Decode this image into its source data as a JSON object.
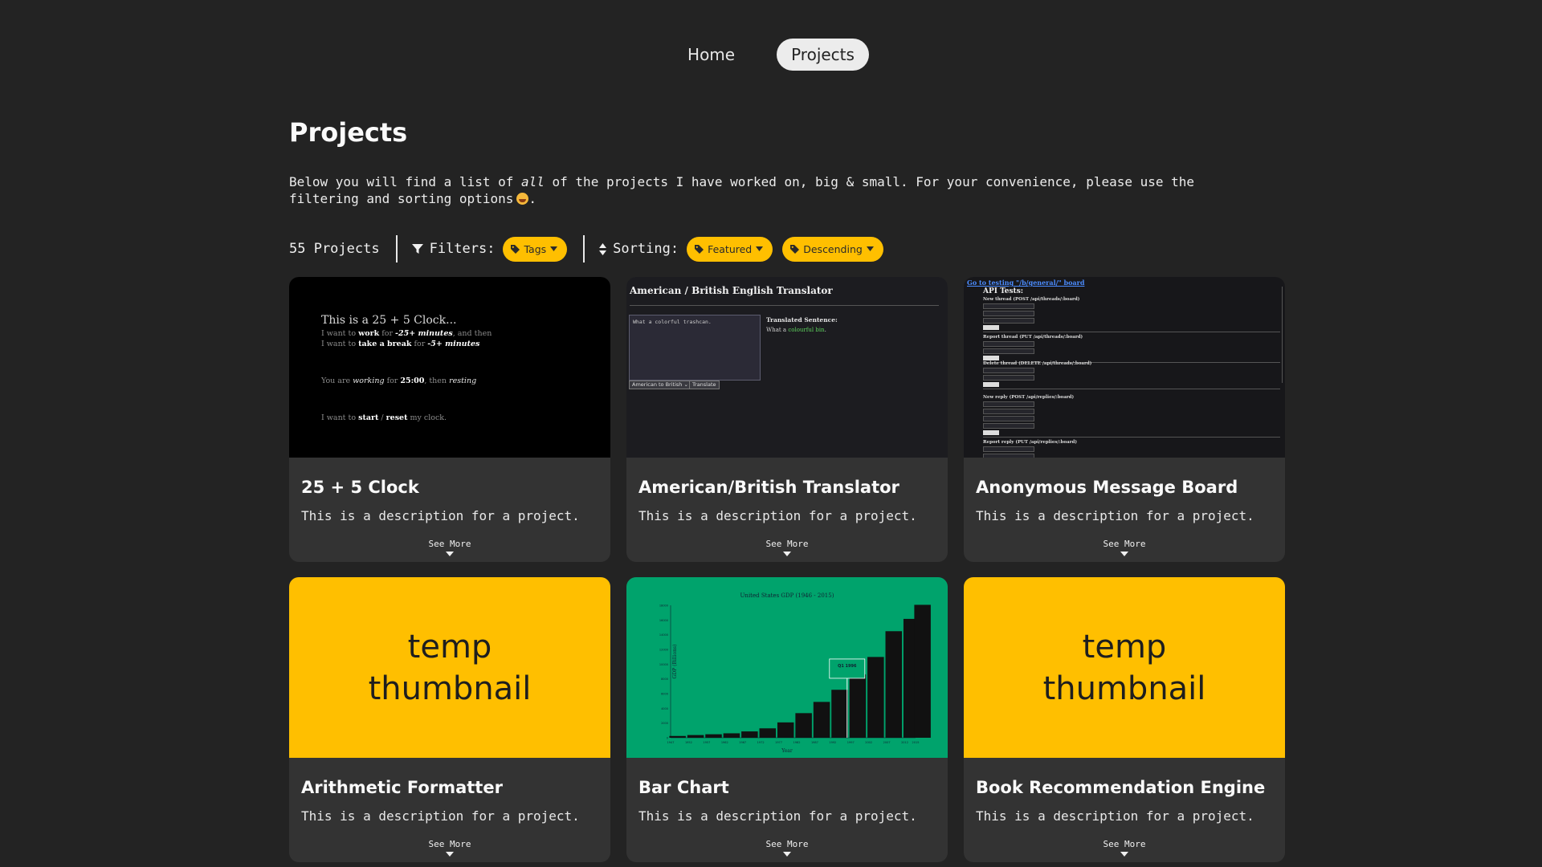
{
  "nav": {
    "home": "Home",
    "projects": "Projects"
  },
  "page": {
    "title": "Projects",
    "intro_before": "Below you will find a list of ",
    "intro_em": "all",
    "intro_after": " of the projects I have worked on, big & small. For your convenience, please use the filtering and sorting options",
    "intro_end": "."
  },
  "controls": {
    "count": "55 Projects",
    "filters_label": "Filters:",
    "tags_label": "Tags",
    "sorting_label": "Sorting:",
    "sort_field": "Featured",
    "sort_order": "Descending"
  },
  "colors": {
    "accent": "#ffbf00",
    "background": "#232323",
    "card": "#333333",
    "chart_green": "#00a36c"
  },
  "cards": [
    {
      "title": "25 + 5 Clock",
      "description": "This is a description for a project.",
      "see_more": "See More",
      "thumb": {
        "heading": "This is a 25 + 5 Clock...",
        "line1_a": "I want to ",
        "line1_b": "work",
        "line1_c": " for ",
        "line1_d": "-25+ minutes",
        "line1_e": ", and then",
        "line2_a": "I want to ",
        "line2_b": "take a break",
        "line2_c": " for ",
        "line2_d": "-5+ minutes",
        "status_a": "You are ",
        "status_b": "working",
        "status_c": " for ",
        "status_d": "25:00",
        "status_e": ", then ",
        "status_f": "resting",
        "ctrl_a": "I want to ",
        "ctrl_b": "start",
        "ctrl_c": " / ",
        "ctrl_d": "reset",
        "ctrl_e": " my clock."
      }
    },
    {
      "title": "American/British Translator",
      "description": "This is a description for a project.",
      "see_more": "See More",
      "thumb": {
        "heading": "American / British English Translator",
        "input": "What a colorful trashcan.",
        "select": "American to British",
        "button": "Translate",
        "result_label": "Translated Sentence:",
        "result_a": "What a ",
        "result_b": "colourful bin",
        "result_c": "."
      }
    },
    {
      "title": "Anonymous Message Board",
      "description": "This is a description for a project.",
      "see_more": "See More",
      "thumb": {
        "link": "Go to testing \"/b/general/\" board",
        "heading": "API Tests:",
        "sections": [
          "New thread (POST /api/threads/:board)",
          "Report thread (PUT /api/threads/:board)",
          "Delete thread (DELETE /api/threads/:board)",
          "New reply (POST /api/replies/:board)",
          "Report reply (PUT /api/replies/:board)"
        ]
      }
    },
    {
      "title": "Arithmetic Formatter",
      "description": "This is a description for a project.",
      "see_more": "See More",
      "thumb": {
        "text": "temp thumbnail"
      }
    },
    {
      "title": "Bar Chart",
      "description": "This is a description for a project.",
      "see_more": "See More",
      "thumb": {
        "chart_title": "United States GDP (1946 - 2015)",
        "ylabel": "GDP (Billions)",
        "xlabel": "Year",
        "tooltip": "Q1 1996"
      }
    },
    {
      "title": "Book Recommendation Engine",
      "description": "This is a description for a project.",
      "see_more": "See More",
      "thumb": {
        "text": "temp thumbnail"
      }
    }
  ],
  "icons": {
    "filter": "filter-icon",
    "sort": "sort-icon",
    "tag": "tag-icon",
    "caret": "caret-down-icon"
  },
  "chart_data": {
    "type": "area",
    "title": "United States GDP (1946 - 2015)",
    "xlabel": "Year",
    "ylabel": "GDP (Billions)",
    "x": [
      1947,
      1952,
      1957,
      1962,
      1967,
      1972,
      1977,
      1982,
      1987,
      1992,
      1997,
      2002,
      2007,
      2012,
      2015
    ],
    "values": [
      243,
      368,
      475,
      604,
      861,
      1280,
      2086,
      3345,
      4870,
      6520,
      8609,
      10978,
      14480,
      16155,
      18064
    ],
    "ylim": [
      0,
      18000
    ],
    "annotation": "Q1 1996"
  }
}
